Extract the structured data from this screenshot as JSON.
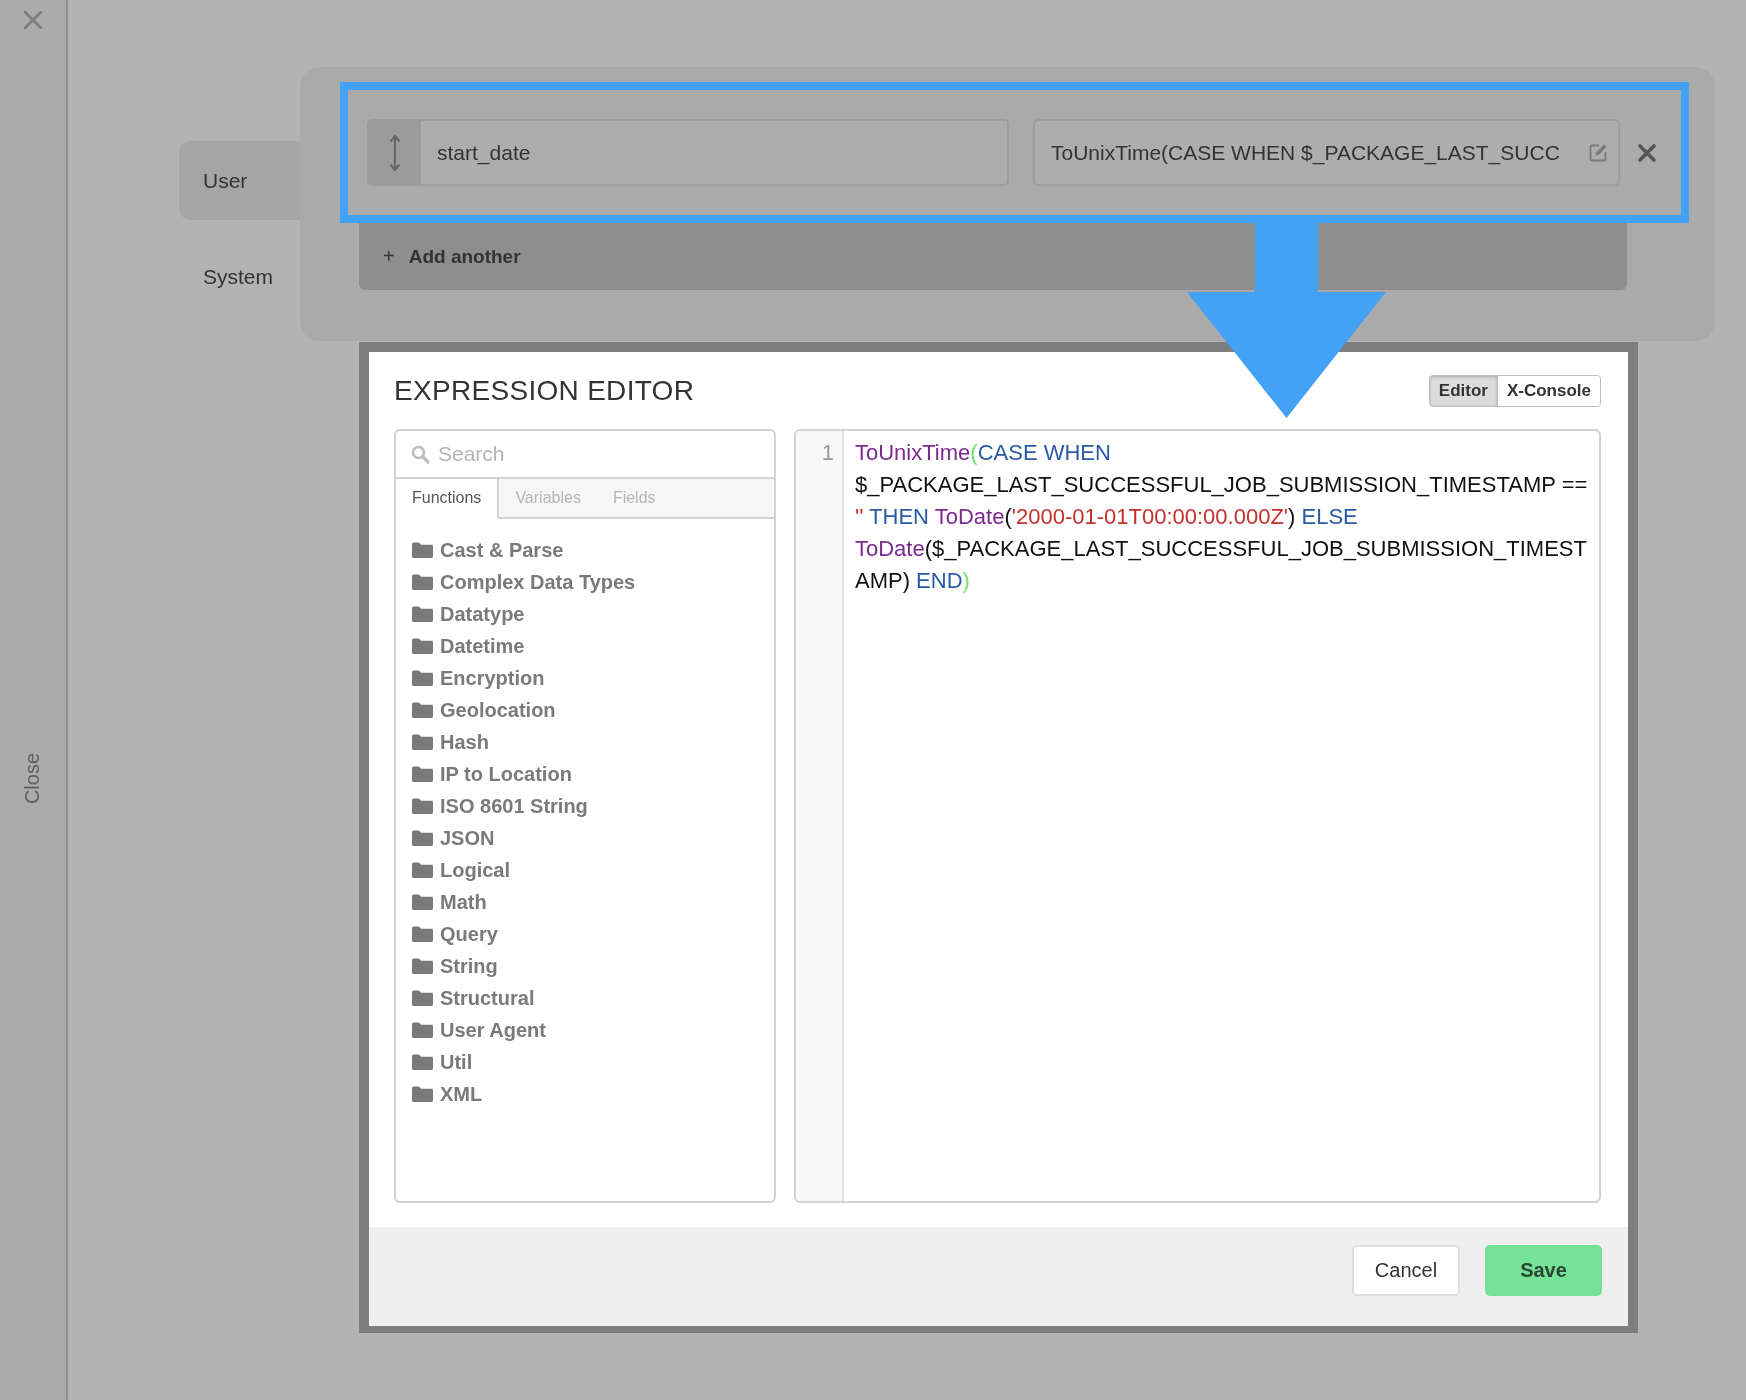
{
  "close_strip": {
    "label": "Close"
  },
  "sidebar": {
    "items": [
      {
        "label": "User",
        "selected": true
      },
      {
        "label": "System",
        "selected": false
      }
    ]
  },
  "mapping_row": {
    "highlighted": true,
    "field_name": "start_date",
    "expression": "ToUnixTime(CASE WHEN $_PACKAGE_LAST_SUCC"
  },
  "add_button": {
    "icon": "+",
    "label": "Add another"
  },
  "expression_editor": {
    "title": "EXPRESSION EDITOR",
    "modes": [
      {
        "label": "Editor",
        "selected": true
      },
      {
        "label": "X-Console",
        "selected": false
      }
    ],
    "search": {
      "placeholder": "Search"
    },
    "tabs": [
      {
        "label": "Functions",
        "selected": true
      },
      {
        "label": "Variables",
        "selected": false
      },
      {
        "label": "Fields",
        "selected": false
      }
    ],
    "categories": [
      "Cast & Parse",
      "Complex Data Types",
      "Datatype",
      "Datetime",
      "Encryption",
      "Geolocation",
      "Hash",
      "IP to Location",
      "ISO 8601 String",
      "JSON",
      "Logical",
      "Math",
      "Query",
      "String",
      "Structural",
      "User Agent",
      "Util",
      "XML"
    ],
    "code": {
      "line_numbers": [
        "1"
      ],
      "tokens": [
        {
          "kind": "function",
          "text": "ToUnixTime"
        },
        {
          "kind": "match",
          "text": "("
        },
        {
          "kind": "keyword",
          "text": "CASE WHEN"
        },
        {
          "kind": "plain",
          "text": " $_PACKAGE_LAST_SUCCESSFUL_JOB_SUBMISSION_TIMESTAMP =="
        },
        {
          "kind": "string",
          "text": " ''"
        },
        {
          "kind": "keyword",
          "text": " THEN"
        },
        {
          "kind": "function",
          "text": " ToDate"
        },
        {
          "kind": "plain",
          "text": "("
        },
        {
          "kind": "string",
          "text": "'2000-01-01T00:00:00.000Z'"
        },
        {
          "kind": "plain",
          "text": ")"
        },
        {
          "kind": "keyword",
          "text": " ELSE"
        },
        {
          "kind": "function",
          "text": " ToDate"
        },
        {
          "kind": "plain",
          "text": "($_PACKAGE_LAST_SUCCESSFUL_JOB_SUBMISSION_TIMESTAMP)"
        },
        {
          "kind": "keyword",
          "text": " END"
        },
        {
          "kind": "match",
          "text": ")"
        }
      ]
    },
    "buttons": [
      {
        "kind": "cancel",
        "label": "Cancel"
      },
      {
        "kind": "save",
        "label": "Save"
      }
    ]
  }
}
